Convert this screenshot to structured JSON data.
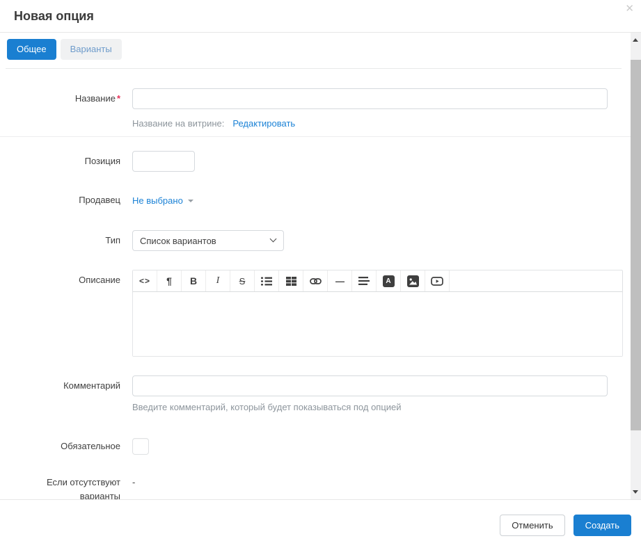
{
  "dialog": {
    "title": "Новая опция",
    "close_glyph": "✕"
  },
  "tabs": [
    {
      "label": "Общее",
      "active": true
    },
    {
      "label": "Варианты",
      "active": false
    }
  ],
  "form": {
    "name": {
      "label": "Название",
      "required_mark": "*",
      "value": "",
      "storefront_label": "Название на витрине:",
      "edit_link": "Редактировать"
    },
    "position": {
      "label": "Позиция",
      "value": ""
    },
    "seller": {
      "label": "Продавец",
      "value": "Не выбрано"
    },
    "type": {
      "label": "Тип",
      "selected": "Список вариантов"
    },
    "description": {
      "label": "Описание",
      "value": "",
      "toolbar": [
        {
          "icon": "code-view-icon",
          "glyph": "<>"
        },
        {
          "icon": "paragraph-format-icon",
          "glyph": "¶"
        },
        {
          "icon": "bold-icon",
          "glyph": "B"
        },
        {
          "icon": "italic-icon",
          "glyph": "I"
        },
        {
          "icon": "strikethrough-icon",
          "glyph": "S"
        },
        {
          "icon": "unordered-list-icon",
          "glyph": ""
        },
        {
          "icon": "insert-table-icon",
          "glyph": ""
        },
        {
          "icon": "insert-link-icon",
          "glyph": ""
        },
        {
          "icon": "horizontal-line-icon",
          "glyph": "—"
        },
        {
          "icon": "align-icon",
          "glyph": ""
        },
        {
          "icon": "font-color-icon",
          "glyph": "A"
        },
        {
          "icon": "insert-image-icon",
          "glyph": ""
        },
        {
          "icon": "insert-video-icon",
          "glyph": ""
        }
      ]
    },
    "comment": {
      "label": "Комментарий",
      "value": "",
      "hint": "Введите комментарий, который будет показываться под опцией"
    },
    "required": {
      "label": "Обязательное",
      "checked": false
    },
    "missing_variants": {
      "label_line1": "Если отсутствуют",
      "label_line2": "варианты",
      "value": "-"
    }
  },
  "footer": {
    "cancel_label": "Отменить",
    "submit_label": "Создать"
  },
  "colors": {
    "accent": "#1a7fd1",
    "link": "#1b82d6",
    "required": "#e8325a"
  }
}
